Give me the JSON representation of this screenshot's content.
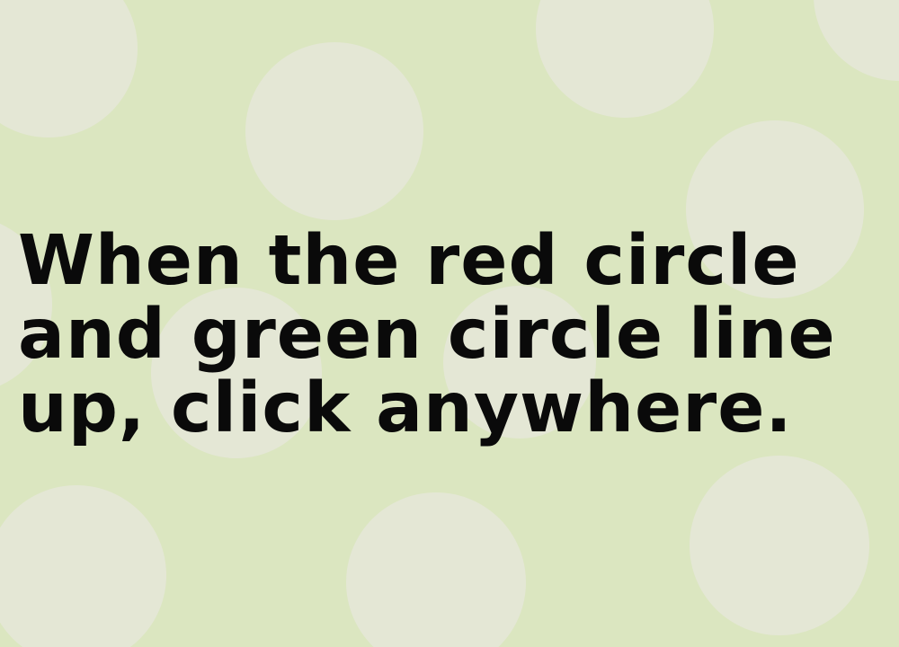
{
  "game": {
    "instruction": "When the red circle\nand green circle line\nup, click anywhere."
  },
  "colors": {
    "background": "#dbe6c0",
    "polka_dot": "#e4e7d5",
    "text": "#0a0a0a"
  }
}
